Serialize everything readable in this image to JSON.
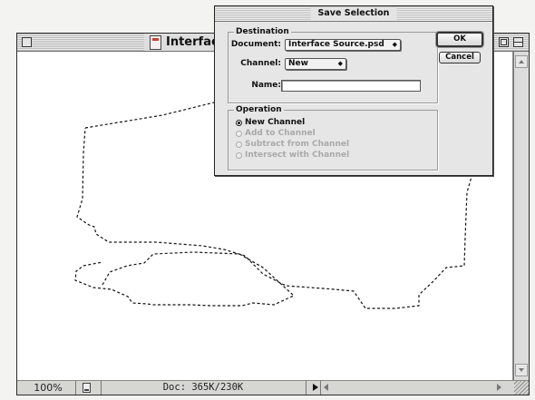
{
  "document_window": {
    "title": "Interface Source.psd",
    "status": {
      "zoom": "100%",
      "doc_info": "Doc: 365K/230K"
    }
  },
  "dialog": {
    "title": "Save Selection",
    "destination": {
      "group_label": "Destination",
      "document_label": "Document:",
      "document_value": "Interface Source.psd",
      "channel_label": "Channel:",
      "channel_value": "New",
      "name_label": "Name:",
      "name_value": ""
    },
    "operation": {
      "group_label": "Operation",
      "options": [
        {
          "label": "New Channel",
          "selected": true,
          "enabled": true
        },
        {
          "label": "Add to Channel",
          "selected": false,
          "enabled": false
        },
        {
          "label": "Subtract from Channel",
          "selected": false,
          "enabled": false
        },
        {
          "label": "Intersect with Channel",
          "selected": false,
          "enabled": false
        }
      ]
    },
    "buttons": {
      "ok": "OK",
      "cancel": "Cancel"
    }
  },
  "icons": {
    "close": "close-box-icon",
    "zoom": "zoom-box-icon",
    "collapse": "collapse-box-icon",
    "file": "photoshop-document-icon",
    "popup": "updown-arrows-icon"
  }
}
